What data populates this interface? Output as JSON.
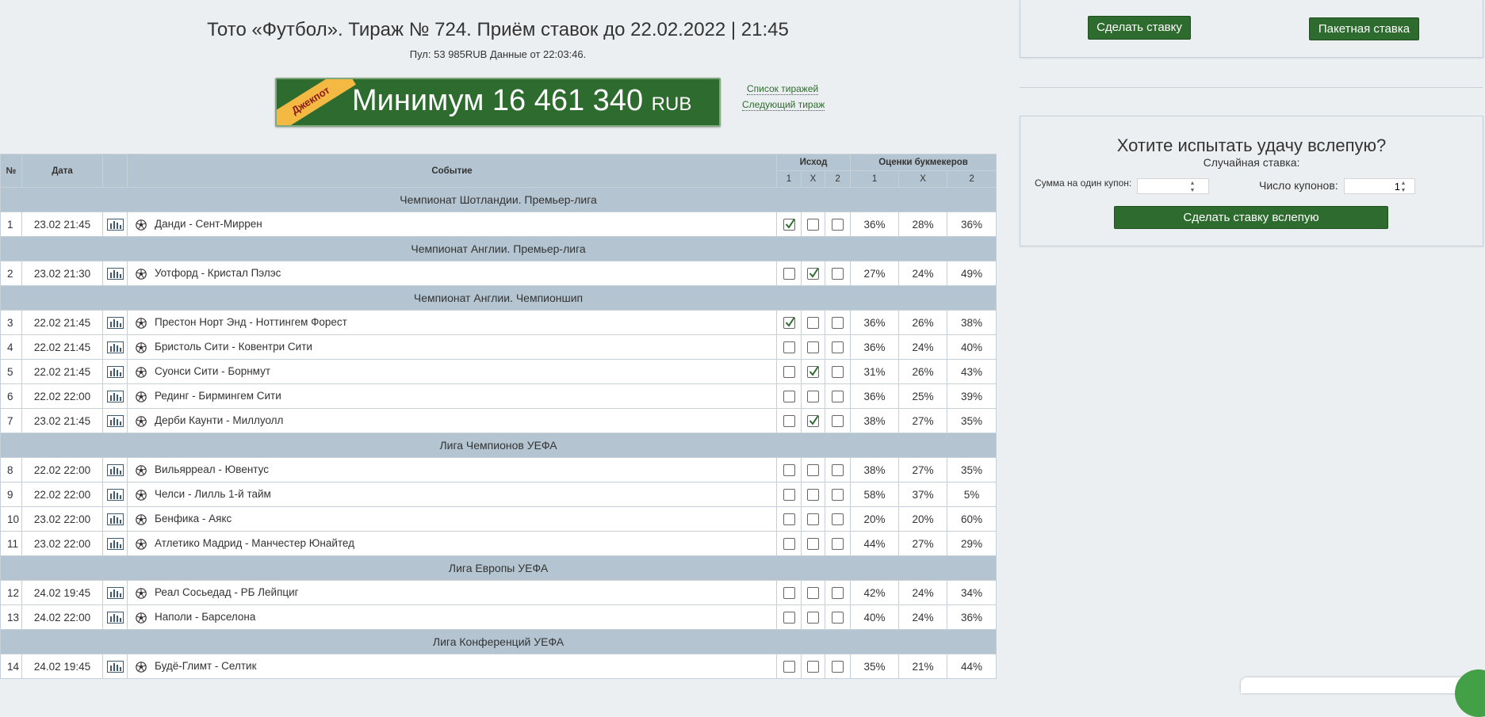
{
  "header": {
    "title": "Тото «Футбол». Тираж № 724. Приём ставок до 22.02.2022 | 21:45",
    "pool_info": "Пул: 53 985RUB Данные от 22:03:46.",
    "jackpot_ribbon": "Джекпот",
    "jackpot_amount": "Минимум 16 461 340",
    "jackpot_currency": "RUB",
    "link_draw_list": "Список тиражей",
    "link_next_draw": "Следующий тираж"
  },
  "table": {
    "headers": {
      "num": "№",
      "date": "Дата",
      "event": "Событие",
      "outcome": "Исход",
      "bookmakers": "Оценки букмекеров",
      "o1": "1",
      "ox": "X",
      "o2": "2",
      "b1": "1",
      "bx": "X",
      "b2": "2"
    },
    "groups": [
      {
        "league": "Чемпионат Шотландии. Премьер-лига",
        "matches": [
          {
            "num": "1",
            "date": "23.02 21:45",
            "event": "Данди - Сент-Миррен",
            "checks": [
              true,
              false,
              false
            ],
            "p1": "36%",
            "px": "28%",
            "p2": "36%"
          }
        ]
      },
      {
        "league": "Чемпионат Англии. Премьер-лига",
        "matches": [
          {
            "num": "2",
            "date": "23.02 21:30",
            "event": "Уотфорд - Кристал Пэлэс",
            "checks": [
              false,
              true,
              false
            ],
            "p1": "27%",
            "px": "24%",
            "p2": "49%"
          }
        ]
      },
      {
        "league": "Чемпионат Англии. Чемпионшип",
        "matches": [
          {
            "num": "3",
            "date": "22.02 21:45",
            "event": "Престон Норт Энд - Ноттингем Форест",
            "checks": [
              true,
              false,
              false
            ],
            "p1": "36%",
            "px": "26%",
            "p2": "38%"
          },
          {
            "num": "4",
            "date": "22.02 21:45",
            "event": "Бристоль Сити - Ковентри Сити",
            "checks": [
              false,
              false,
              false
            ],
            "p1": "36%",
            "px": "24%",
            "p2": "40%"
          },
          {
            "num": "5",
            "date": "22.02 21:45",
            "event": "Суонси Сити - Борнмут",
            "checks": [
              false,
              true,
              false
            ],
            "p1": "31%",
            "px": "26%",
            "p2": "43%"
          },
          {
            "num": "6",
            "date": "22.02 22:00",
            "event": "Рединг - Бирмингем Сити",
            "checks": [
              false,
              false,
              false
            ],
            "p1": "36%",
            "px": "25%",
            "p2": "39%"
          },
          {
            "num": "7",
            "date": "23.02 21:45",
            "event": "Дерби Каунти - Миллуолл",
            "checks": [
              false,
              true,
              false
            ],
            "p1": "38%",
            "px": "27%",
            "p2": "35%"
          }
        ]
      },
      {
        "league": "Лига Чемпионов УЕФА",
        "matches": [
          {
            "num": "8",
            "date": "22.02 22:00",
            "event": "Вильярреал - Ювентус",
            "checks": [
              false,
              false,
              false
            ],
            "p1": "38%",
            "px": "27%",
            "p2": "35%"
          },
          {
            "num": "9",
            "date": "22.02 22:00",
            "event": "Челси - Лилль 1-й тайм",
            "checks": [
              false,
              false,
              false
            ],
            "p1": "58%",
            "px": "37%",
            "p2": "5%"
          },
          {
            "num": "10",
            "date": "23.02 22:00",
            "event": "Бенфика - Аякс",
            "checks": [
              false,
              false,
              false
            ],
            "p1": "20%",
            "px": "20%",
            "p2": "60%"
          },
          {
            "num": "11",
            "date": "23.02 22:00",
            "event": "Атлетико Мадрид - Манчестер Юнайтед",
            "checks": [
              false,
              false,
              false
            ],
            "p1": "44%",
            "px": "27%",
            "p2": "29%"
          }
        ]
      },
      {
        "league": "Лига Европы УЕФА",
        "matches": [
          {
            "num": "12",
            "date": "24.02 19:45",
            "event": "Реал Сосьедад - РБ Лейпциг",
            "checks": [
              false,
              false,
              false
            ],
            "p1": "42%",
            "px": "24%",
            "p2": "34%"
          },
          {
            "num": "13",
            "date": "24.02 22:00",
            "event": "Наполи - Барселона",
            "checks": [
              false,
              false,
              false
            ],
            "p1": "40%",
            "px": "24%",
            "p2": "36%"
          }
        ]
      },
      {
        "league": "Лига Конференций УЕФА",
        "matches": [
          {
            "num": "14",
            "date": "24.02 19:45",
            "event": "Будё-Глимт - Селтик",
            "checks": [
              false,
              false,
              false
            ],
            "p1": "35%",
            "px": "21%",
            "p2": "44%"
          }
        ]
      }
    ]
  },
  "bet_panel": {
    "make_bet": "Сделать ставку",
    "batch_bet": "Пакетная ставка"
  },
  "blind_panel": {
    "title": "Хотите испытать удачу вслепую?",
    "subtitle": "Случайная ставка:",
    "amount_label": "Сумма на один купон:",
    "amount_value": "",
    "coupons_label": "Число купонов:",
    "coupons_value": "1",
    "button": "Сделать ставку вслепую"
  },
  "colors": {
    "brand_green": "#2e6b2e",
    "table_header": "#b4c5d1",
    "jackpot_ribbon": "#f4b942"
  },
  "icons": {
    "stats": "bar-chart-icon",
    "sport": "soccer-ball-icon",
    "check": "checkmark-icon"
  }
}
